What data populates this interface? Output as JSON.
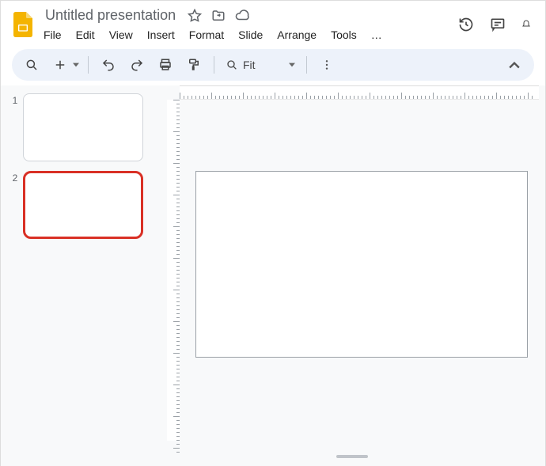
{
  "header": {
    "title": "Untitled presentation"
  },
  "menus": [
    "File",
    "Edit",
    "View",
    "Insert",
    "Format",
    "Slide",
    "Arrange",
    "Tools",
    "…"
  ],
  "toolbar": {
    "zoom_label": "Fit"
  },
  "thumbs": [
    {
      "n": "1",
      "selected": false
    },
    {
      "n": "2",
      "selected": true
    }
  ]
}
